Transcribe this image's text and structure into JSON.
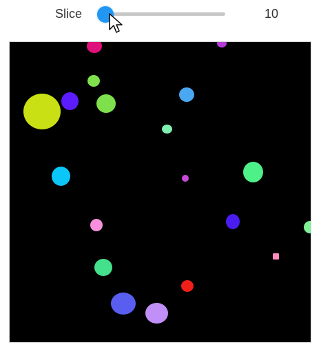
{
  "slider": {
    "label": "Slice",
    "value": "10",
    "value_fraction": 0.0,
    "track_color": "#c7c7c7",
    "thumb_color": "#2196f3"
  },
  "image_view": {
    "background": "#000000",
    "blob_colors": [
      "#e0107a",
      "#b43cd8",
      "#7ee04c",
      "#c8e014",
      "#5b1cff",
      "#7ee04c",
      "#4aa8f0",
      "#7ff0b0",
      "#0bc6f8",
      "#ca4ad8",
      "#4ef088",
      "#f78fdc",
      "#4a1cf0",
      "#7ff094",
      "#ff8cc0",
      "#44e08c",
      "#f02018",
      "#5a5ef0",
      "#c090f8"
    ]
  }
}
